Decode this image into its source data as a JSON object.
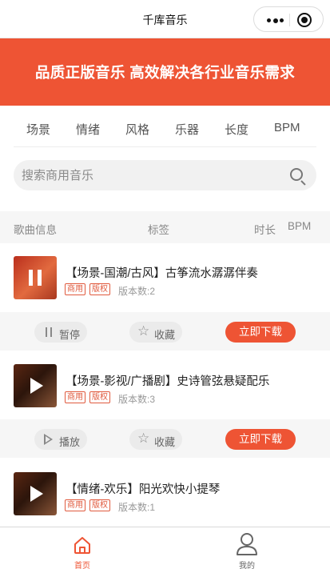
{
  "app": {
    "title": "千库音乐"
  },
  "banner": {
    "text": "品质正版音乐 高效解决各行业音乐需求"
  },
  "filters": [
    "场景",
    "情绪",
    "风格",
    "乐器",
    "长度",
    "BPM"
  ],
  "search": {
    "placeholder": "搜索商用音乐"
  },
  "table_header": {
    "info": "歌曲信息",
    "tags": "标签",
    "duration": "时长",
    "bpm": "BPM"
  },
  "songs": [
    {
      "title": "【场景-国潮/古风】古筝流水潺潺伴奏",
      "tags": [
        "商用",
        "版权"
      ],
      "versions": "版本数:2",
      "state": "playing"
    },
    {
      "title": "【场景-影视/广播剧】史诗管弦悬疑配乐",
      "tags": [
        "商用",
        "版权"
      ],
      "versions": "版本数:3",
      "state": "stopped"
    },
    {
      "title": "【情绪-欢乐】阳光欢快小提琴",
      "tags": [
        "商用",
        "版权"
      ],
      "versions": "版本数:1",
      "state": "stopped"
    }
  ],
  "actions": [
    {
      "play": "暂停",
      "favorite": "收藏",
      "download": "立即下载"
    },
    {
      "play": "播放",
      "favorite": "收藏",
      "download": "立即下载"
    }
  ],
  "tabbar": [
    {
      "label": "首页",
      "icon": "home-icon",
      "active": true
    },
    {
      "label": "我的",
      "icon": "user-icon",
      "active": false
    }
  ],
  "colors": {
    "accent": "#ee5434",
    "tag": "#e05a3e",
    "inactive": "#666666"
  }
}
